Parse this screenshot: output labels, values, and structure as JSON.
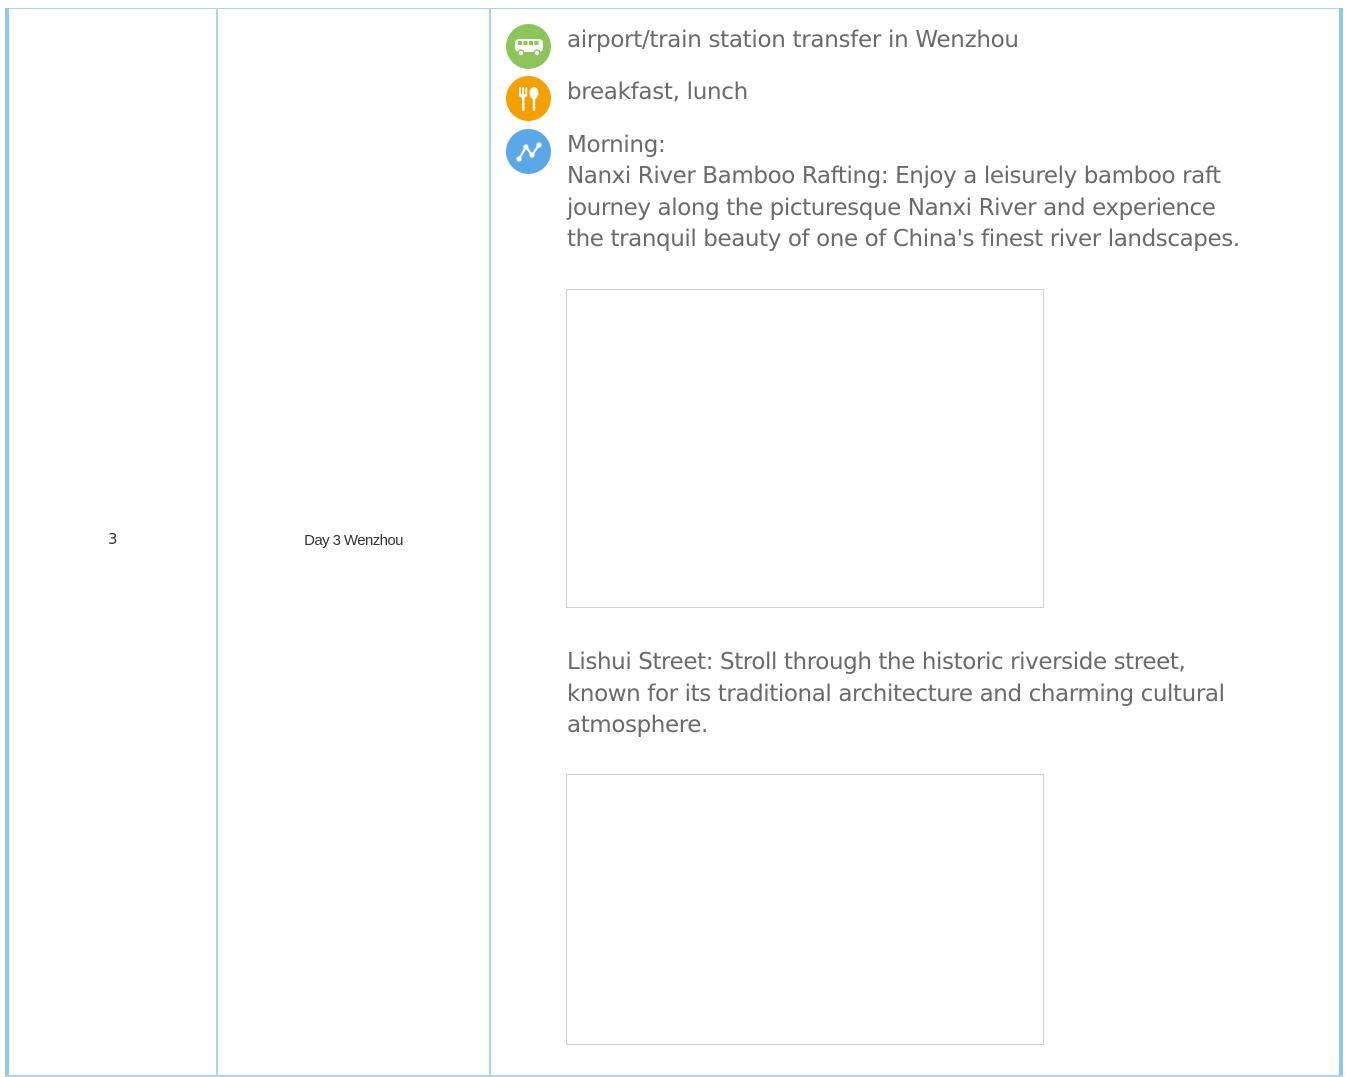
{
  "row": {
    "number": "3",
    "day_label": "Day 3 Wenzhou"
  },
  "items": {
    "transfer": {
      "icon": "bus-icon",
      "color": "#8cc55a",
      "text": "airport/train station transfer in Wenzhou"
    },
    "meals": {
      "icon": "fork-spoon-icon",
      "color": "#f6a000",
      "text": "breakfast, lunch"
    },
    "route": {
      "icon": "route-icon",
      "color": "#5aa8e8",
      "text": "Morning:"
    }
  },
  "activities": {
    "nanxi": "Nanxi River Bamboo Rafting: Enjoy a leisurely bamboo raft journey along the picturesque Nanxi River and experience the tranquil beauty of one of China's finest river landscapes.",
    "lishui": "Lishui Street: Stroll through the historic riverside street, known for its traditional architecture and charming cultural atmosphere."
  }
}
